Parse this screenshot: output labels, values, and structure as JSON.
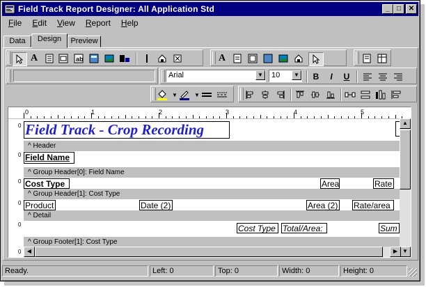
{
  "window": {
    "title": "Field Track Report Designer: All Application Std"
  },
  "titlebar_buttons": {
    "minimize": "_",
    "maximize": "□",
    "close": "✕"
  },
  "menu": [
    "File",
    "Edit",
    "View",
    "Report",
    "Help"
  ],
  "menu_underline": [
    "F",
    "E",
    "V",
    "R",
    "H"
  ],
  "tabs": [
    "Data",
    "Design",
    "Preview"
  ],
  "active_tab": "Design",
  "toolbar": {
    "text_field_value": "",
    "font_name": "Arial",
    "font_size": "10",
    "bold": "B",
    "italic": "I",
    "underline": "U"
  },
  "ruler": {
    "marks": [
      "0",
      "1",
      "2",
      "3",
      "4",
      "5"
    ]
  },
  "report": {
    "title": "Field Track - Crop Recording",
    "bands": [
      "^ Header",
      "^ Group Header[0]: Field Name",
      "^ Group Header[1]: Cost Type",
      "^ Detail",
      "^ Group Footer[1]: Cost Type"
    ],
    "fields": {
      "field_name": "Field Name",
      "cost_type": "Cost Type",
      "area_header": "Area",
      "rate_header": "Rate",
      "product": "Product",
      "date2": "Date (2)",
      "area2": "Area (2)",
      "rate_area": "Rate/area",
      "cost_type_footer": "Cost Type",
      "total_area": "Total/Area:",
      "sum": "Sum"
    },
    "row_marker": "0"
  },
  "status": {
    "ready": "Ready.",
    "left": "Left: 0",
    "top": "Top: 0",
    "width": "Width: 0",
    "height": "Height: 0"
  },
  "colors": {
    "title_bar": "#000080",
    "report_title": "#1f1fcf",
    "face": "#c0c0c0"
  }
}
